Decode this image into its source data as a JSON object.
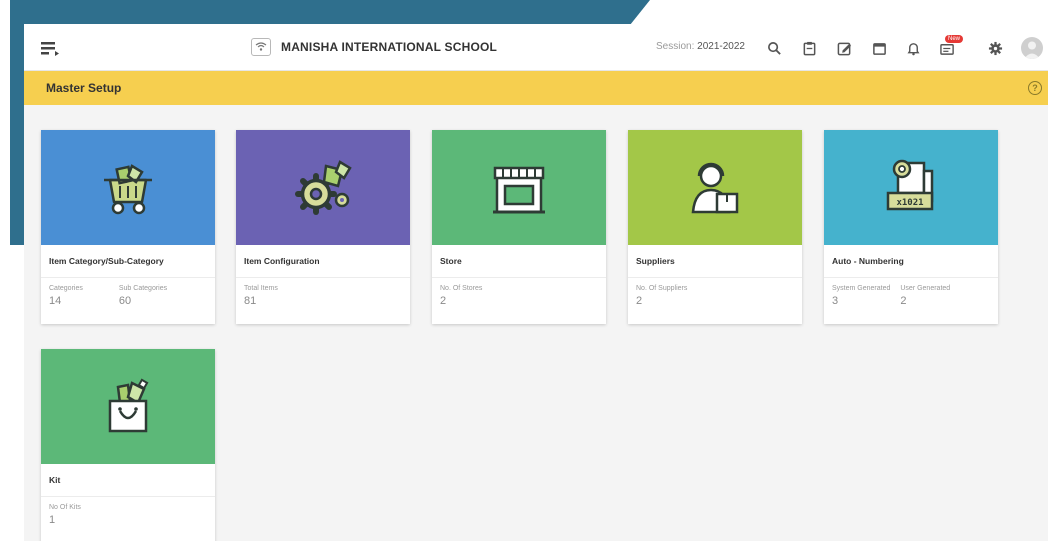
{
  "topbar": {
    "school_name": "MANISHA INTERNATIONAL SCHOOL",
    "session_label": "Session:",
    "session_value": "2021-2022",
    "notification_badge": "New"
  },
  "header": {
    "title": "Master Setup"
  },
  "colors": {
    "header_yellow": "#f6cf4f",
    "card_blue": "#4a8fd4",
    "card_purple": "#6b62b3",
    "card_green": "#5cb878",
    "card_lime": "#a3c748",
    "card_cyan": "#45b2cd",
    "frame": "#2f6f8d"
  },
  "cards": [
    {
      "title": "Item Category/Sub-Category",
      "icon": "cart-icon",
      "stats": [
        {
          "label": "Categories",
          "value": "14"
        },
        {
          "label": "Sub Categories",
          "value": "60"
        }
      ]
    },
    {
      "title": "Item Configuration",
      "icon": "gear-items-icon",
      "stats": [
        {
          "label": "Total Items",
          "value": "81"
        }
      ]
    },
    {
      "title": "Store",
      "icon": "store-icon",
      "stats": [
        {
          "label": "No. Of Stores",
          "value": "2"
        }
      ]
    },
    {
      "title": "Suppliers",
      "icon": "supplier-icon",
      "stats": [
        {
          "label": "No. Of Suppliers",
          "value": "2"
        }
      ]
    },
    {
      "title": "Auto - Numbering",
      "icon": "numbering-icon",
      "badge_text": "x1021",
      "stats": [
        {
          "label": "System Generated",
          "value": "3"
        },
        {
          "label": "User Generated",
          "value": "2"
        }
      ]
    },
    {
      "title": "Kit",
      "icon": "kit-bag-icon",
      "stats": [
        {
          "label": "No Of Kits",
          "value": "1"
        }
      ]
    }
  ]
}
